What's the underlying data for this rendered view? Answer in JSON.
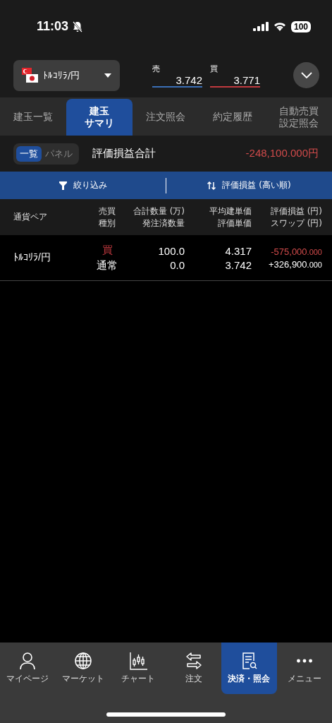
{
  "status_bar": {
    "time": "11:03",
    "battery": "100"
  },
  "pair_selector": {
    "label": "ﾄﾙｺﾘﾗ/円"
  },
  "quotes": [
    {
      "label": "売",
      "value": "3.742",
      "color": "#3b6fb6"
    },
    {
      "label": "買",
      "value": "3.771",
      "color": "#c0393f"
    }
  ],
  "tabs": [
    {
      "label": [
        "建玉一覧"
      ],
      "selected": false
    },
    {
      "label": [
        "建玉",
        "サマリ"
      ],
      "selected": true
    },
    {
      "label": [
        "注文照会"
      ],
      "selected": false
    },
    {
      "label": [
        "約定履歴"
      ],
      "selected": false
    },
    {
      "label": [
        "自動売買",
        "設定照会"
      ],
      "selected": false
    }
  ],
  "view_toggle": [
    {
      "label": "一覧",
      "selected": true
    },
    {
      "label": "パネル",
      "selected": false
    }
  ],
  "summary": {
    "label": "評価損益合計",
    "value": "-248,100.000円",
    "negative": true
  },
  "filter_bar": {
    "filter": "絞り込み",
    "sort": "評価損益 (高い順)"
  },
  "table": {
    "columns": [
      [
        "通貨ペア"
      ],
      [
        "売買",
        "種別"
      ],
      [
        "合計数量 (万)",
        "発注済数量"
      ],
      [
        "平均建単価",
        "評価単価"
      ],
      [
        "評価損益 (円)",
        "スワップ (円)"
      ]
    ],
    "rows": [
      {
        "pair": "ﾄﾙｺﾘﾗ/円",
        "side": "買",
        "type": "通常",
        "quantity": "100.0",
        "ordered": "0.0",
        "avg_price": "4.317",
        "eval_price": "3.742",
        "pnl": {
          "integer": "-575,000",
          "fraction": ".000",
          "negative": true
        },
        "swap": {
          "integer": "+326,900",
          "fraction": ".000",
          "negative": false
        }
      }
    ]
  },
  "nav": [
    {
      "label": "マイページ",
      "kind": "person",
      "selected": false
    },
    {
      "label": "マーケット",
      "kind": "globe",
      "selected": false
    },
    {
      "label": "チャート",
      "kind": "chart",
      "selected": false
    },
    {
      "label": "注文",
      "kind": "arrows",
      "selected": false
    },
    {
      "label": "決済・照会",
      "kind": "document",
      "selected": true
    },
    {
      "label": "メニュー",
      "kind": "dots",
      "selected": false
    }
  ]
}
